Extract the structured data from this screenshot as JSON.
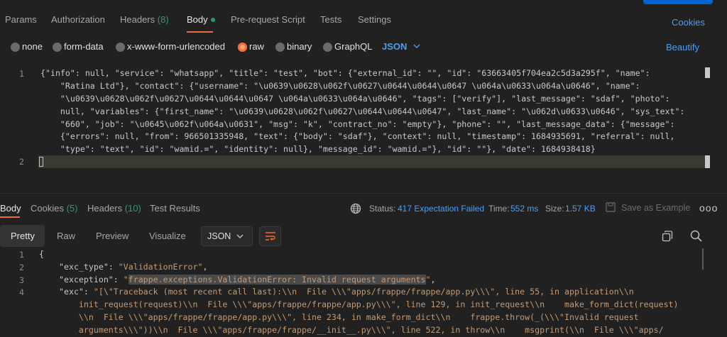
{
  "request_tabs": [
    {
      "label": "Params"
    },
    {
      "label": "Authorization"
    },
    {
      "label": "Headers",
      "count": "(8)"
    },
    {
      "label": "Body",
      "active": true
    },
    {
      "label": "Pre-request Script"
    },
    {
      "label": "Tests"
    },
    {
      "label": "Settings"
    }
  ],
  "cookies_label": "Cookies",
  "body_types": {
    "none": "none",
    "form_data": "form-data",
    "urlencoded": "x-www-form-urlencoded",
    "raw": "raw",
    "binary": "binary",
    "graphql": "GraphQL"
  },
  "body_format": "JSON",
  "beautify_label": "Beautify",
  "request_lines": [
    "{\"info\": null, \"service\": \"whatsapp\", \"title\": \"test\", \"bot\": {\"external_id\": \"\", \"id\": \"63663405f704ea2c5d3a295f\", \"name\":",
    "    \"Ratina Ltd\"}, \"contact\": {\"username\": \"\\u0639\\u0628\\u062f\\u0627\\u0644\\u0644\\u0647 \\u064a\\u0633\\u064a\\u0646\", \"name\":",
    "    \"\\u0639\\u0628\\u062f\\u0627\\u0644\\u0644\\u0647 \\u064a\\u0633\\u064a\\u0646\", \"tags\": [\"verify\"], \"last_message\": \"sdaf\", \"photo\":",
    "    null, \"variables\": {\"first_name\": \"\\u0639\\u0628\\u062f\\u0627\\u0644\\u0644\\u0647\", \"last_name\": \"\\u062d\\u0633\\u0646\", \"sys_text\":",
    "    \"660\", \"job\": \"\\u0645\\u062f\\u064a\\u0631\", \"msg\": \"k\", \"contract_no\": \"empty\"}, \"phone\": \"\", \"last_message_data\": {\"message\":",
    "    {\"errors\": null, \"from\": 966501335948, \"text\": {\"body\": \"sdaf\"}, \"context\": null, \"timestamp\": 1684935691, \"referral\": null,",
    "    \"type\": \"text\", \"id\": \"wamid.=\", \"identity\": null}, \"message_id\": \"wamid.=\"}, \"id\": \"\"}, \"date\": 1684938418}"
  ],
  "line_numbers": {
    "req1": "1",
    "req2": "2",
    "r1": "1",
    "r2": "2",
    "r3": "3",
    "r4": "4"
  },
  "response_tabs": [
    {
      "label": "Body",
      "active": true
    },
    {
      "label": "Cookies",
      "count": "(5)"
    },
    {
      "label": "Headers",
      "count": "(10)"
    },
    {
      "label": "Test Results"
    }
  ],
  "status": {
    "status_label": "Status:",
    "status_value": "417 Expectation Failed",
    "time_label": "Time:",
    "time_value": "552 ms",
    "size_label": "Size:",
    "size_value": "1.57 KB"
  },
  "save_example_label": "Save as Example",
  "more_label": "ooo",
  "view_tabs": [
    "Pretty",
    "Raw",
    "Preview",
    "Visualize"
  ],
  "response_format": "JSON",
  "response": {
    "open_brace": "{",
    "exc_type_key": "\"exc_type\"",
    "exc_type_val": "\"ValidationError\"",
    "exception_key": "\"exception\"",
    "exception_val": "frappe.exceptions.ValidationError: Invalid request arguments",
    "exc_key": "\"exc\"",
    "exc_lines": [
      "\"[\\\"Traceback (most recent call last):\\\\n  File \\\\\\\"apps/frappe/frappe/app.py\\\\\\\", line 55, in application\\\\n",
      "    init_request(request)\\\\n  File \\\\\\\"apps/frappe/frappe/app.py\\\\\\\", line 129, in init_request\\\\n    make_form_dict(request)",
      "    \\\\n  File \\\\\\\"apps/frappe/frappe/app.py\\\\\\\", line 234, in make_form_dict\\\\n    frappe.throw(_(\\\\\\\"Invalid request",
      "    arguments\\\\\\\"))\\\\n  File \\\\\\\"apps/frappe/frappe/__init__.py\\\\\\\", line 522, in throw\\\\n    msgprint(\\\\n  File \\\\\\\"apps/"
    ]
  }
}
